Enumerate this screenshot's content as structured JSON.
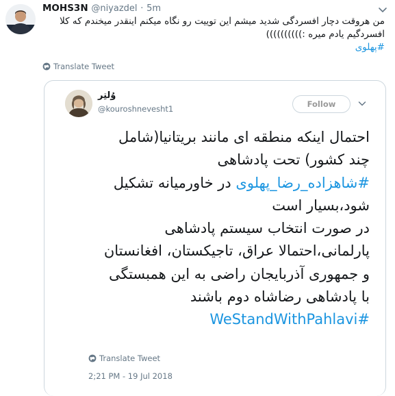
{
  "tweet": {
    "display_name": "MOHS3N",
    "handle": "@niyazdel",
    "time": "5m",
    "separator": "·",
    "text": "من هروقت دچار افسردگی شدید میشم این توییت رو نگاه میکنم اینقدر میخندم که کلا افسردگیم یادم میره :))))))))))",
    "hashtag": "#پهلوی",
    "translate_label": "Translate Tweet"
  },
  "quoted": {
    "display_name": "وُلتِر",
    "handle": "@kouroshnevesht1",
    "follow_label": "Follow",
    "lines": [
      {
        "text": "احتمال اینکه منطقه ای مانند بریتانیا(شامل"
      },
      {
        "text": "چند کشور) تحت پادشاهی"
      },
      {
        "hashtag": "#شاهزاده_رضا_پهلوی",
        "text": " در خاورمیانه تشکیل"
      },
      {
        "text": "شود،بسیار است"
      },
      {
        "text": "در صورت انتخاب سیستم پادشاهی"
      },
      {
        "text": "پارلمانی،احتمالا عراق، تاجیکستان، افغانستان"
      },
      {
        "text": "و جمهوری آذربایجان راضی به این همبستگی"
      },
      {
        "text": "با پادشاهی رضاشاه دوم باشند"
      },
      {
        "hashtag": "#WeStandWithPahlavi",
        "text": ""
      }
    ],
    "translate_label": "Translate Tweet",
    "timestamp": "2;21 PM - 19 Jul 2018"
  },
  "colors": {
    "link": "#1b95e0",
    "secondary_text": "#657786",
    "border": "#ccd6dd"
  },
  "icons": [
    "avatar",
    "chevron-down-icon",
    "globe-icon"
  ]
}
